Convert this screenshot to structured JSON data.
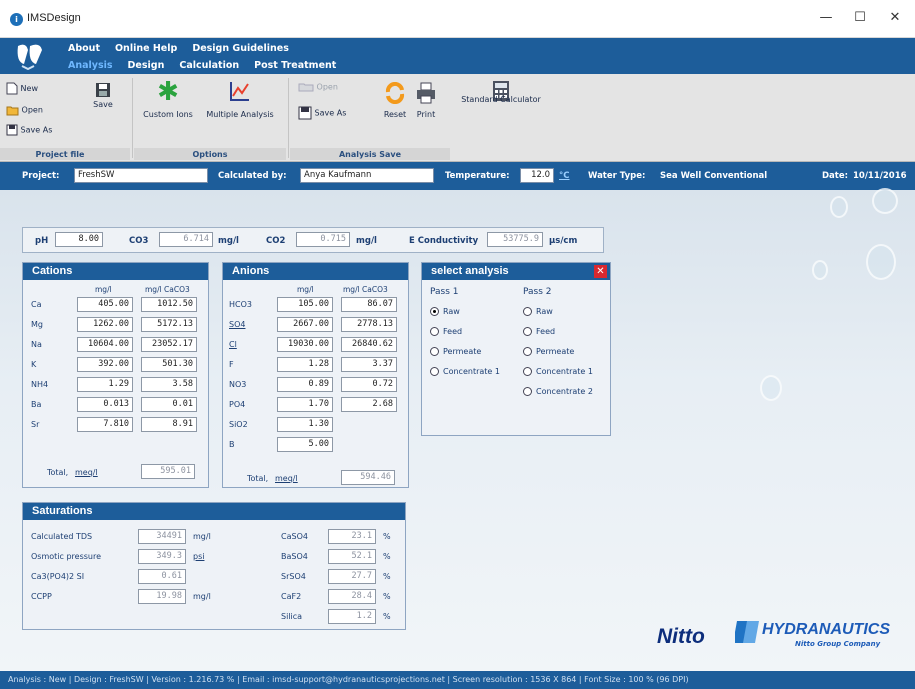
{
  "window": {
    "title": "IMSDesign",
    "minimize": "—",
    "maximize": "☐",
    "close": "✕"
  },
  "menu": {
    "row1": [
      "About",
      "Online Help",
      "Design Guidelines"
    ],
    "row2": [
      "Analysis",
      "Design",
      "Calculation",
      "Post Treatment"
    ],
    "active": "Analysis"
  },
  "ribbon": {
    "project_file": {
      "new": "New",
      "open": "Open",
      "save": "Save",
      "save_as": "Save As",
      "group": "Project file"
    },
    "options": {
      "custom_ions": "Custom Ions",
      "multiple_analysis": "Multiple Analysis",
      "group": "Options"
    },
    "analysis_save": {
      "open": "Open",
      "save_as": "Save As",
      "reset": "Reset",
      "print": "Print",
      "group": "Analysis Save"
    },
    "standard_calculator": "Standard Calculator"
  },
  "project_bar": {
    "project_label": "Project:",
    "project_value": "FreshSW",
    "calculated_by_label": "Calculated by:",
    "calculated_by_value": "Anya Kaufmann",
    "temperature_label": "Temperature:",
    "temperature_value": "12.0",
    "temperature_unit": "°C",
    "water_type_label": "Water Type:",
    "water_type_value": "Sea Well Conventional",
    "date_label": "Date:",
    "date_value": "10/11/2016"
  },
  "ph_row": {
    "ph_label": "pH",
    "ph_value": "8.00",
    "co3_label": "CO3",
    "co3_value": "6.714",
    "co3_unit": "mg/l",
    "co2_label": "CO2",
    "co2_value": "0.715",
    "co2_unit": "mg/l",
    "ec_label": "E Conductivity",
    "ec_value": "53775.9",
    "ec_unit": "µs/cm"
  },
  "cations": {
    "title": "Cations",
    "col1": "mg/l",
    "col2": "mg/l CaCO3",
    "rows": [
      {
        "ion": "Ca",
        "mgl": "405.00",
        "caco3": "1012.50"
      },
      {
        "ion": "Mg",
        "mgl": "1262.00",
        "caco3": "5172.13"
      },
      {
        "ion": "Na",
        "mgl": "10604.00",
        "caco3": "23052.17"
      },
      {
        "ion": "K",
        "mgl": "392.00",
        "caco3": "501.30"
      },
      {
        "ion": "NH4",
        "mgl": "1.29",
        "caco3": "3.58"
      },
      {
        "ion": "Ba",
        "mgl": "0.013",
        "caco3": "0.01"
      },
      {
        "ion": "Sr",
        "mgl": "7.810",
        "caco3": "8.91"
      }
    ],
    "total_label": "Total,",
    "total_unit": "meq/l",
    "total_value": "595.01"
  },
  "anions": {
    "title": "Anions",
    "col1": "mg/l",
    "col2": "mg/l CaCO3",
    "rows": [
      {
        "ion": "HCO3",
        "mgl": "105.00",
        "caco3": "86.07"
      },
      {
        "ion": "SO4",
        "mgl": "2667.00",
        "caco3": "2778.13"
      },
      {
        "ion": "Cl",
        "mgl": "19030.00",
        "caco3": "26840.62"
      },
      {
        "ion": "F",
        "mgl": "1.28",
        "caco3": "3.37"
      },
      {
        "ion": "NO3",
        "mgl": "0.89",
        "caco3": "0.72"
      },
      {
        "ion": "PO4",
        "mgl": "1.70",
        "caco3": "2.68"
      },
      {
        "ion": "SiO2",
        "mgl": "1.30",
        "caco3": ""
      },
      {
        "ion": "B",
        "mgl": "5.00",
        "caco3": ""
      }
    ],
    "total_label": "Total,",
    "total_unit": "meq/l",
    "total_value": "594.46"
  },
  "select_analysis": {
    "title": "select analysis",
    "pass1": {
      "label": "Pass 1",
      "options": [
        "Raw",
        "Feed",
        "Permeate",
        "Concentrate 1"
      ],
      "selected": "Raw"
    },
    "pass2": {
      "label": "Pass 2",
      "options": [
        "Raw",
        "Feed",
        "Permeate",
        "Concentrate 1",
        "Concentrate 2"
      ],
      "selected": ""
    }
  },
  "saturations": {
    "title": "Saturations",
    "left": [
      {
        "label": "Calculated TDS",
        "value": "34491",
        "unit": "mg/l"
      },
      {
        "label": "Osmotic pressure",
        "value": "349.3",
        "unit": "psi"
      },
      {
        "label": "Ca3(PO4)2 SI",
        "value": "0.61",
        "unit": ""
      },
      {
        "label": "CCPP",
        "value": "19.98",
        "unit": "mg/l"
      }
    ],
    "right": [
      {
        "label": "CaSO4",
        "value": "23.1",
        "unit": "%"
      },
      {
        "label": "BaSO4",
        "value": "52.1",
        "unit": "%"
      },
      {
        "label": "SrSO4",
        "value": "27.7",
        "unit": "%"
      },
      {
        "label": "CaF2",
        "value": "28.4",
        "unit": "%"
      },
      {
        "label": "Silica",
        "value": "1.2",
        "unit": "%"
      }
    ]
  },
  "brand": {
    "nitto": "Nitto",
    "hydranautics": "HYDRANAUTICS",
    "hydranautics_sub": "Nitto Group Company"
  },
  "status_bar": "Analysis : New |   Design : FreshSW |   Version : 1.216.73 % |   Email : imsd-support@hydranauticsprojections.net |   Screen resolution : 1536 X 864 | Font Size : 100 % (96 DPI)"
}
